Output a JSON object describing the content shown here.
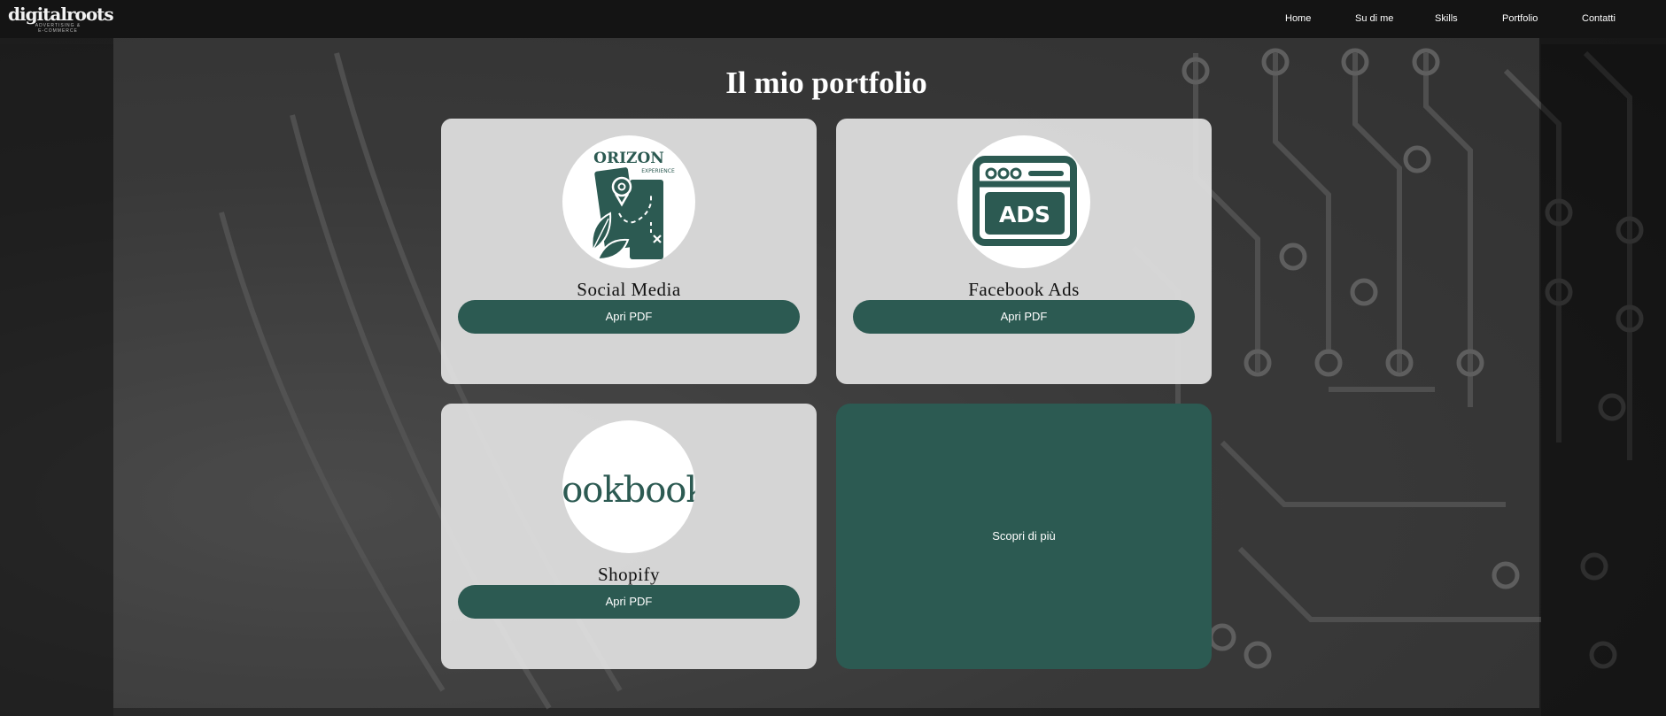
{
  "header": {
    "logo_text": "digitalroots",
    "logo_sub_1": "ADVERTISING &",
    "logo_sub_2": "E-COMMERCE",
    "nav": [
      "Home",
      "Su di me",
      "Skills",
      "Portfolio",
      "Contatti"
    ]
  },
  "main": {
    "title": "Il mio portfolio",
    "cards": [
      {
        "title": "Social Media",
        "button": "Apri PDF",
        "icon": "orizon-map-icon",
        "icon_text": "ORIZON",
        "icon_subtext": "EXPERIENCE"
      },
      {
        "title": "Facebook Ads",
        "button": "Apri PDF",
        "icon": "ads-browser-icon",
        "icon_text": "ADS"
      },
      {
        "title": "Shopify",
        "button": "Apri PDF",
        "icon": "lookbook-logo",
        "icon_text": "lookbook"
      }
    ],
    "more": {
      "label": "Scopri di più"
    }
  },
  "colors": {
    "accent": "#2c5a52",
    "topbar": "#141414",
    "card": "#e1e1e1"
  }
}
